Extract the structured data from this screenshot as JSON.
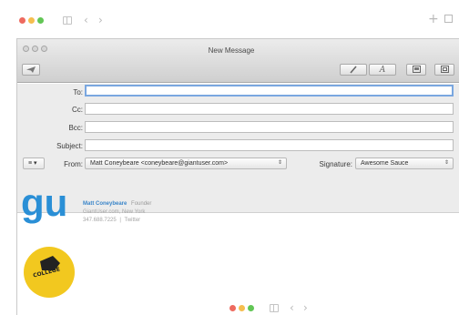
{
  "outer": {
    "colors": {
      "close": "#ee6a5f",
      "minimize": "#f5be4f",
      "zoom": "#62c655"
    },
    "icons": [
      "sidebar-icon",
      "back-icon",
      "forward-icon",
      "add-icon",
      "tabs-icon"
    ],
    "back_glyph": "‹",
    "forward_glyph": "›",
    "add_glyph": "+"
  },
  "window": {
    "title": "New Message",
    "toolbar_icons": [
      "send-icon",
      "attach-icon",
      "format-icon",
      "photo-browser-icon",
      "stationery-icon"
    ]
  },
  "header": {
    "to_label": "To:",
    "cc_label": "Cc:",
    "bcc_label": "Bcc:",
    "subject_label": "Subject:",
    "to_value": "",
    "cc_value": "",
    "bcc_value": "",
    "subject_value": "",
    "from_label": "From:",
    "from_value": "Matt Coneybeare <coneybeare@giantuser.com>",
    "signature_label": "Signature:",
    "signature_value": "Awesome Sauce",
    "options_glyph": "≡ ▾"
  },
  "signature": {
    "logo_text": "gu",
    "name": "Matt Coneybeare",
    "role": "Founder",
    "company": "GiantUser.com, New York",
    "phone": "347.688.7225",
    "twitter": "Twitter",
    "badge_text": "COLLEGE"
  }
}
